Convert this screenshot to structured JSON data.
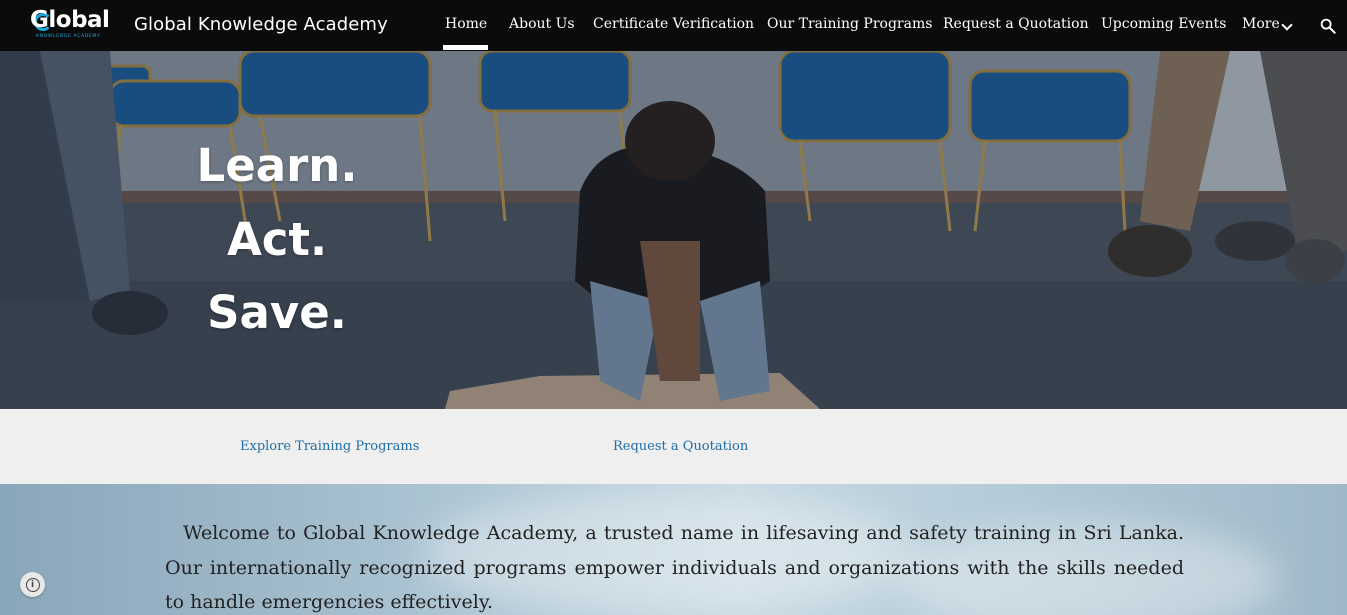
{
  "logo": {
    "word": "Global",
    "subtitle": "KNOWLEDGE ACADEMY"
  },
  "site_title": "Global Knowledge Academy",
  "nav": {
    "items": [
      {
        "label": "Home"
      },
      {
        "label": "About Us"
      },
      {
        "label": "Certificate Verification"
      },
      {
        "label": "Our Training Programs"
      },
      {
        "label": "Request a Quotation"
      },
      {
        "label": "Upcoming Events"
      },
      {
        "label": "More"
      }
    ],
    "active": "Home"
  },
  "hero": {
    "lines": [
      "Learn.",
      "Act.",
      "Save."
    ]
  },
  "links": {
    "explore": "Explore Training Programs",
    "quote": "Request a Quotation"
  },
  "welcome": {
    "text": "Welcome to Global Knowledge Academy, a trusted name in lifesaving and safety training in Sri Lanka. Our internationally recognized programs empower individuals and organizations with the skills needed to handle emergencies effectively."
  },
  "colors": {
    "topbar": "#0b0b0b",
    "link": "#1f6ea6",
    "logo_accent": "#1ea7d6"
  },
  "icons": {
    "search": "search-icon",
    "more": "chevron-down-icon",
    "info": "info-icon"
  }
}
